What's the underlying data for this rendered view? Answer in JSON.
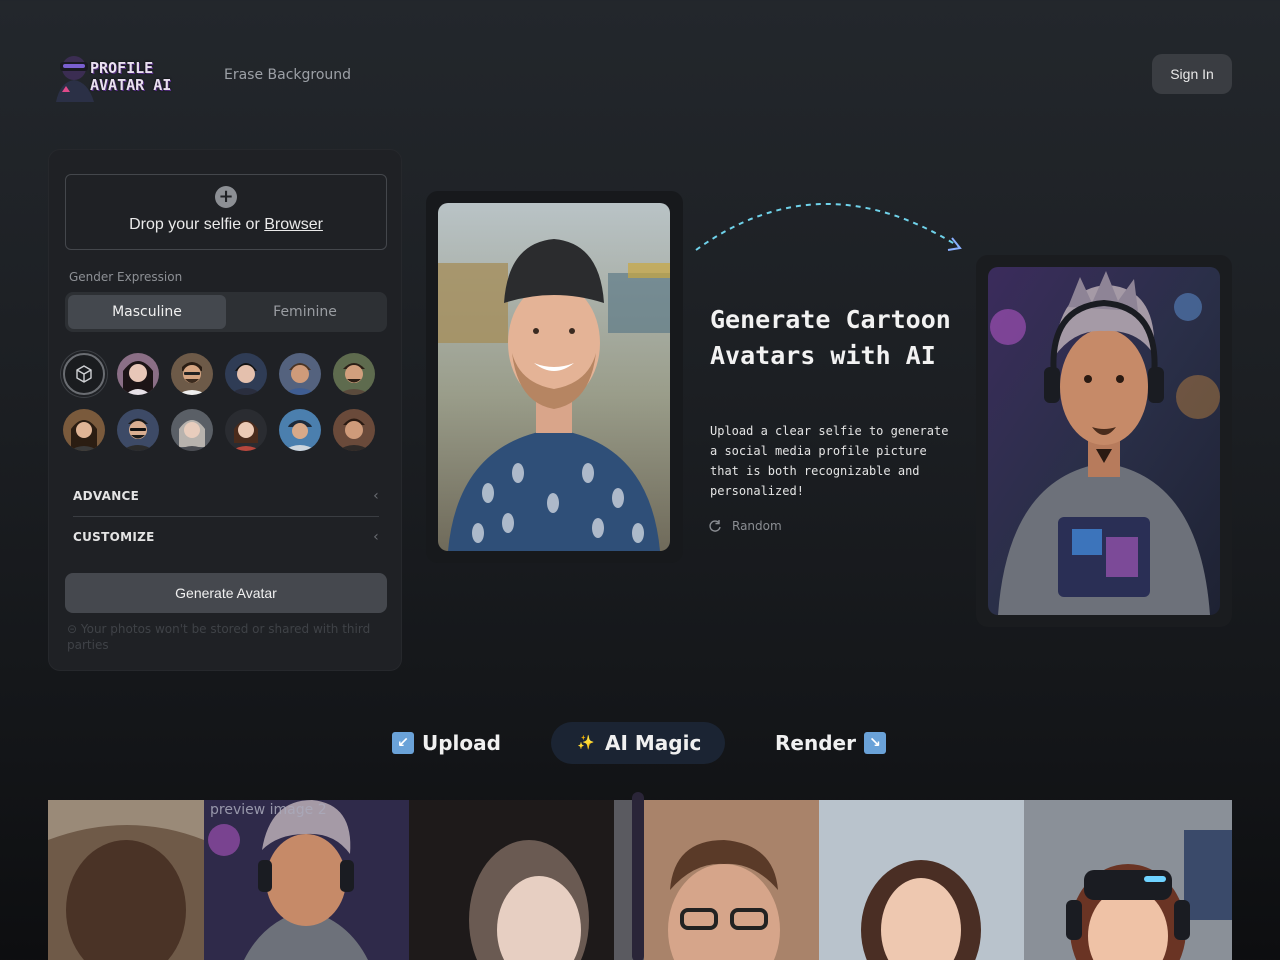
{
  "header": {
    "logo_line1": "PROFILE",
    "logo_line2": "AVATAR AI",
    "nav_erase": "Erase Background",
    "signin_label": "Sign In"
  },
  "panel": {
    "drop_prefix": "Drop your selfie or ",
    "drop_link": "Browser",
    "gender_label": "Gender Expression",
    "gender_options": [
      "Masculine",
      "Feminine"
    ],
    "gender_selected": "Masculine",
    "advance_label": "ADVANCE",
    "customize_label": "CUSTOMIZE",
    "generate_label": "Generate Avatar",
    "privacy_note": "Your photos won't be stored or shared with third parties"
  },
  "hero": {
    "headline": "Generate Cartoon Avatars with AI",
    "subtext": "Upload a clear selfie to generate a social media profile picture that is both recognizable and personalized!",
    "random_label": "Random"
  },
  "steps": {
    "upload": "Upload",
    "magic": "AI Magic",
    "render": "Render"
  },
  "gallery": {
    "broken_alt": "preview image 2"
  },
  "icons": [
    "plus-circle-icon",
    "cube-icon",
    "chevron-left-icon",
    "refresh-icon",
    "arrow-down-left-icon",
    "magic-wand-icon",
    "arrow-down-right-icon"
  ],
  "colors": {
    "background": "#1c1f23",
    "panel": "#1f2125",
    "button": "#45484e",
    "accent_dash": "#6fd2ea",
    "step_active_bg": "#1b2433"
  }
}
